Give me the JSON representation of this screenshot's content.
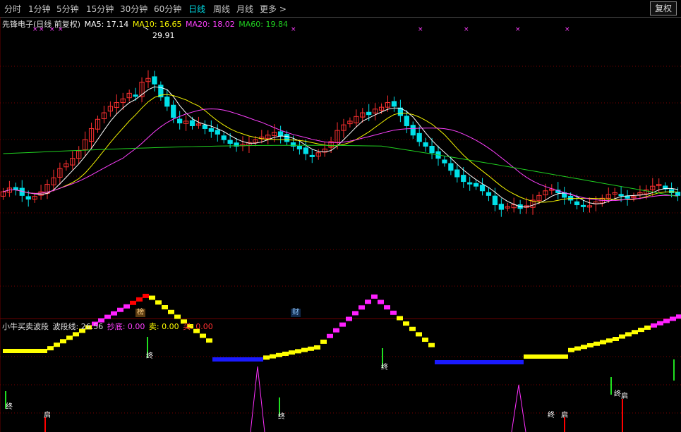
{
  "toolbar": {
    "tabs": [
      "分时",
      "1分钟",
      "5分钟",
      "15分钟",
      "30分钟",
      "60分钟",
      "日线",
      "周线",
      "月线",
      "更多 >"
    ],
    "active_tab": "日线",
    "restore_label": "复权"
  },
  "main_legend": {
    "stock_title": "先锋电子(日线 前复权)",
    "ma5": "MA5: 17.14",
    "ma10": "MA10: 16.65",
    "ma20": "MA20: 18.02",
    "ma60": "MA60: 19.84"
  },
  "peak_label": "29.91",
  "event_markers": {
    "bang": "榜",
    "cai": "财"
  },
  "sub_legend": {
    "title": "小牛买卖波段",
    "wave_line": "波段线: 26.56",
    "chaodi": "抄底: 0.00",
    "mai_sell": "卖: 0.00",
    "mai_buy": "买: 0.00"
  },
  "signal_labels": {
    "zhong": "终",
    "qi": "启"
  },
  "colors": {
    "up": "#ff3030",
    "down": "#00e0e8",
    "ma5": "#ffffff",
    "ma10": "#f5f500",
    "ma20": "#ff40ff",
    "ma60": "#20d020",
    "grid": "#7a0000",
    "wave_yellow": "#ffff00",
    "wave_magenta": "#ff20ff",
    "wave_red": "#ff0000",
    "wave_blue": "#1a1aff",
    "signal_green": "#20e020",
    "signal_red": "#ff0000",
    "signal_magenta": "#ff30ff"
  },
  "chart_data": {
    "type": "candlestick",
    "price_range": [
      10,
      32
    ],
    "candles_close_trend": [
      15,
      15.4,
      15.2,
      14.6,
      14.2,
      14.5,
      15,
      15.8,
      16.5,
      17.5,
      18,
      18.6,
      19.4,
      20.6,
      21.8,
      22.8,
      23.5,
      24.2,
      24.6,
      25,
      25.6,
      25.3,
      26.8,
      27.2,
      26.6,
      25.2,
      24.2,
      23,
      22.4,
      22.6,
      22.1,
      22.3,
      21.8,
      21.5,
      21.2,
      20.6,
      20.2,
      19.9,
      20.1,
      20.3,
      20.6,
      20.9,
      21.1,
      21.4,
      21.0,
      20.4,
      19.9,
      19.6,
      19.1,
      18.9,
      19.2,
      19.6,
      20.4,
      21.6,
      22.2,
      22.6,
      23.1,
      23.5,
      23.3,
      23.9,
      24.1,
      24.6,
      24.2,
      23.2,
      22.1,
      21.1,
      20.4,
      19.9,
      19.2,
      18.6,
      18.1,
      17.3,
      16.6,
      16.1,
      15.9,
      15.6,
      15.1,
      14.6,
      13.6,
      13.1,
      13.4,
      13.6,
      13.2,
      13.5,
      14.1,
      14.6,
      15.1,
      15.3,
      14.9,
      14.4,
      14.1,
      13.6,
      13.4,
      13.5,
      13.9,
      14.3,
      14.7,
      14.9,
      14.6,
      14.3,
      14.5,
      14.9,
      15.2,
      15.6,
      15.8,
      15.3,
      14.9,
      14.6
    ]
  }
}
